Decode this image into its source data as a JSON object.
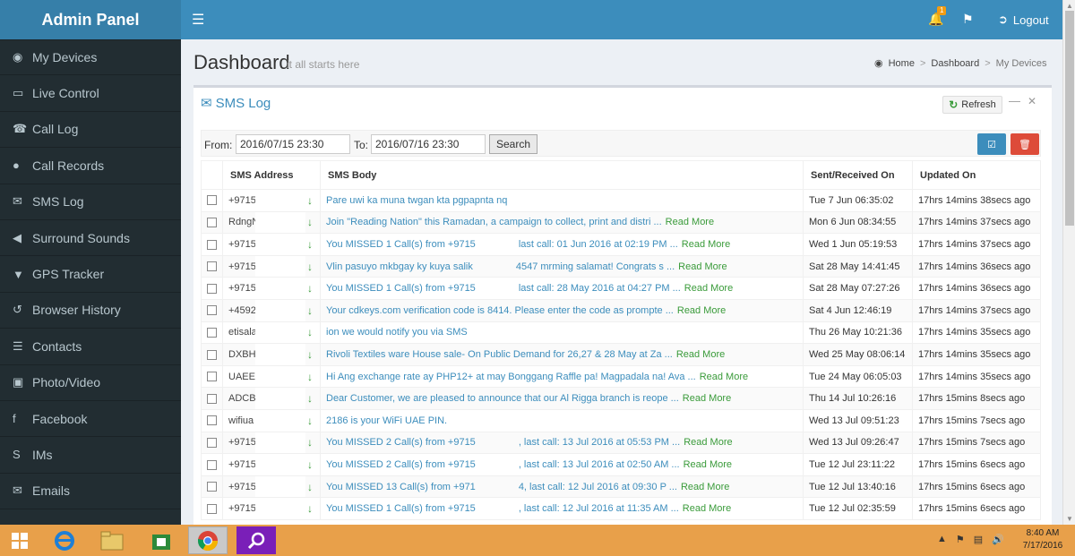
{
  "brand": "Admin Panel",
  "sidebar": {
    "items": [
      {
        "label": "My Devices",
        "icon": "dashboard-icon"
      },
      {
        "label": "Live Control",
        "icon": "laptop-icon"
      },
      {
        "label": "Call Log",
        "icon": "phone-icon"
      },
      {
        "label": "Call Records",
        "icon": "microphone-icon"
      },
      {
        "label": "SMS Log",
        "icon": "envelope-icon"
      },
      {
        "label": "Surround Sounds",
        "icon": "volume-icon"
      },
      {
        "label": "GPS Tracker",
        "icon": "map-marker-icon"
      },
      {
        "label": "Browser History",
        "icon": "history-icon"
      },
      {
        "label": "Contacts",
        "icon": "list-icon"
      },
      {
        "label": "Photo/Video",
        "icon": "camera-icon"
      },
      {
        "label": "Facebook",
        "icon": "facebook-icon"
      },
      {
        "label": "IMs",
        "icon": "skype-icon"
      },
      {
        "label": "Emails",
        "icon": "envelope-icon"
      }
    ]
  },
  "header": {
    "notification_count": "1",
    "logout_label": "Logout"
  },
  "page": {
    "title": "Dashboard",
    "subtitle": "it all starts here",
    "breadcrumb": [
      "Home",
      "Dashboard",
      "My Devices"
    ]
  },
  "box": {
    "title": "SMS Log",
    "refresh_label": "Refresh"
  },
  "filter": {
    "from_label": "From:",
    "from_value": "2016/07/15 23:30",
    "to_label": "To:",
    "to_value": "2016/07/16 23:30",
    "search_label": "Search"
  },
  "table": {
    "columns": [
      "SMS Address",
      "SMS Body",
      "Sent/Received On",
      "Updated On"
    ],
    "read_more": "Read More",
    "rows": [
      {
        "addr": "+9715",
        "body": "Pare uwi ka muna twgan kta pgpapnta nq",
        "more": false,
        "sent": "Tue 7 Jun 06:35:02",
        "updated": "17hrs 14mins 38secs ago"
      },
      {
        "addr": "RdngN",
        "body": "Join \"Reading Nation\" this Ramadan, a campaign to collect, print and distri ...",
        "more": true,
        "sent": "Mon 6 Jun 08:34:55",
        "updated": "17hrs 14mins 37secs ago"
      },
      {
        "addr": "+9715",
        "body": "You MISSED 1 Call(s) from +9715",
        "body2": "last call: 01 Jun 2016 at 02:19 PM ...",
        "more": true,
        "sent": "Wed 1 Jun 05:19:53",
        "updated": "17hrs 14mins 37secs ago"
      },
      {
        "addr": "+9715",
        "body": "Vlin pasuyo mkbgay ky kuya salik",
        "body2": "4547 mrming salamat! Congrats s ...",
        "more": true,
        "sent": "Sat 28 May 14:41:45",
        "updated": "17hrs 14mins 36secs ago"
      },
      {
        "addr": "+9715",
        "body": "You MISSED 1 Call(s) from +9715",
        "body2": "last call: 28 May 2016 at 04:27 PM ...",
        "more": true,
        "sent": "Sat 28 May 07:27:26",
        "updated": "17hrs 14mins 36secs ago"
      },
      {
        "addr": "+4592",
        "body": "Your cdkeys.com verification code is 8414. Please enter the code as prompte ...",
        "more": true,
        "sent": "Sat 4 Jun 12:46:19",
        "updated": "17hrs 14mins 37secs ago"
      },
      {
        "addr": "etisala",
        "body": "ion we would notify you via SMS",
        "more": false,
        "sent": "Thu 26 May 10:21:36",
        "updated": "17hrs 14mins 35secs ago"
      },
      {
        "addr": "DXBH",
        "body": "Rivoli Textiles ware House sale- On Public Demand for 26,27 & 28 May at Za ...",
        "more": true,
        "sent": "Wed 25 May 08:06:14",
        "updated": "17hrs 14mins 35secs ago"
      },
      {
        "addr": "UAEE",
        "body": "Hi Ang exchange rate ay PHP12+ at may Bonggang Raffle pa! Magpadala na! Ava ...",
        "more": true,
        "sent": "Tue 24 May 06:05:03",
        "updated": "17hrs 14mins 35secs ago"
      },
      {
        "addr": "ADCB",
        "body": "Dear Customer, we are pleased to announce that our Al Rigga branch is reope ...",
        "more": true,
        "sent": "Thu 14 Jul 10:26:16",
        "updated": "17hrs 15mins 8secs ago"
      },
      {
        "addr": "wifiua",
        "body": "2186 is your WiFi UAE PIN.",
        "more": false,
        "sent": "Wed 13 Jul 09:51:23",
        "updated": "17hrs 15mins 7secs ago"
      },
      {
        "addr": "+9715",
        "body": "You MISSED 2 Call(s) from +9715",
        "body2": ", last call: 13 Jul 2016 at 05:53 PM ...",
        "more": true,
        "sent": "Wed 13 Jul 09:26:47",
        "updated": "17hrs 15mins 7secs ago"
      },
      {
        "addr": "+9715",
        "body": "You MISSED 2 Call(s) from +9715",
        "body2": ", last call: 13 Jul 2016 at 02:50 AM ...",
        "more": true,
        "sent": "Tue 12 Jul 23:11:22",
        "updated": "17hrs 15mins 6secs ago"
      },
      {
        "addr": "+9715",
        "body": "You MISSED 13 Call(s) from +971",
        "body2": "4, last call: 12 Jul 2016 at 09:30 P ...",
        "more": true,
        "sent": "Tue 12 Jul 13:40:16",
        "updated": "17hrs 15mins 6secs ago"
      },
      {
        "addr": "+9715",
        "body": "You MISSED 1 Call(s) from +9715",
        "body2": ", last call: 12 Jul 2016 at 11:35 AM ...",
        "more": true,
        "sent": "Tue 12 Jul 02:35:59",
        "updated": "17hrs 15mins 6secs ago"
      }
    ]
  },
  "taskbar": {
    "time": "8:40 AM",
    "date": "7/17/2016"
  }
}
